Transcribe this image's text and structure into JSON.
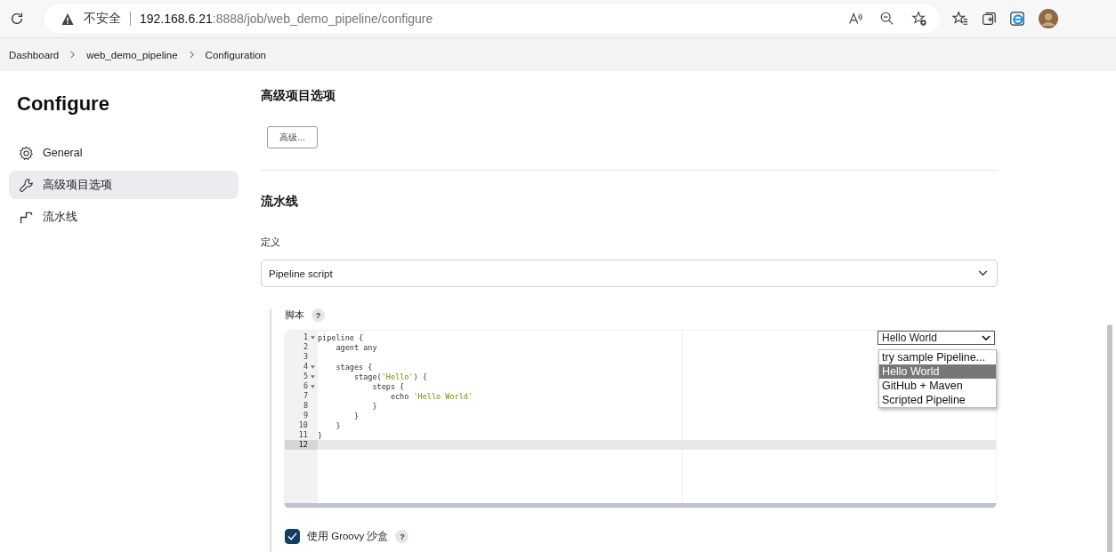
{
  "browser": {
    "security": "不安全",
    "url_host": "192.168.6.21",
    "url_rest": ":8888/job/web_demo_pipeline/configure"
  },
  "breadcrumbs": [
    "Dashboard",
    "web_demo_pipeline",
    "Configuration"
  ],
  "sidebar": {
    "title": "Configure",
    "items": [
      {
        "label": "General",
        "selected": false
      },
      {
        "label": "高级项目选项",
        "selected": true
      },
      {
        "label": "流水线",
        "selected": false
      }
    ]
  },
  "advanced": {
    "heading": "高级项目选项",
    "button": "高级..."
  },
  "pipeline": {
    "heading": "流水线",
    "definition_label": "定义",
    "definition_value": "Pipeline script",
    "script_label": "脚本",
    "help": "?",
    "code": [
      {
        "num": "1",
        "fold": true,
        "current": false,
        "segments": [
          {
            "text": "pipeline {",
            "kind": "plain"
          }
        ]
      },
      {
        "num": "2",
        "fold": false,
        "current": false,
        "segments": [
          {
            "text": "    agent any",
            "kind": "plain"
          }
        ]
      },
      {
        "num": "3",
        "fold": false,
        "current": false
      },
      {
        "num": "4",
        "fold": true,
        "current": false,
        "segments": [
          {
            "text": "    stages {",
            "kind": "plain"
          }
        ]
      },
      {
        "num": "5",
        "fold": true,
        "current": false,
        "segments": [
          {
            "text": "        stage(",
            "kind": "plain"
          },
          {
            "text": "'Hello'",
            "kind": "string"
          },
          {
            "text": ") {",
            "kind": "plain"
          }
        ]
      },
      {
        "num": "6",
        "fold": true,
        "current": false,
        "segments": [
          {
            "text": "            steps {",
            "kind": "plain"
          }
        ]
      },
      {
        "num": "7",
        "fold": false,
        "current": false,
        "segments": [
          {
            "text": "                echo ",
            "kind": "plain"
          },
          {
            "text": "'Hello World'",
            "kind": "string"
          }
        ]
      },
      {
        "num": "8",
        "fold": false,
        "current": false,
        "segments": [
          {
            "text": "            }",
            "kind": "plain"
          }
        ]
      },
      {
        "num": "9",
        "fold": false,
        "current": false,
        "segments": [
          {
            "text": "        }",
            "kind": "plain"
          }
        ]
      },
      {
        "num": "10",
        "fold": false,
        "current": false,
        "segments": [
          {
            "text": "    }",
            "kind": "plain"
          }
        ]
      },
      {
        "num": "11",
        "fold": false,
        "current": false,
        "segments": [
          {
            "text": "}",
            "kind": "plain"
          }
        ]
      },
      {
        "num": "12",
        "fold": false,
        "current": true
      }
    ],
    "sample_select": "Hello World",
    "sample_options": [
      {
        "label": "try sample Pipeline...",
        "selected": false
      },
      {
        "label": "Hello World",
        "selected": true
      },
      {
        "label": "GitHub + Maven",
        "selected": false
      },
      {
        "label": "Scripted Pipeline",
        "selected": false
      }
    ],
    "sandbox": {
      "label": "使用 Groovy 沙盒",
      "checked": true,
      "help": "?"
    }
  }
}
